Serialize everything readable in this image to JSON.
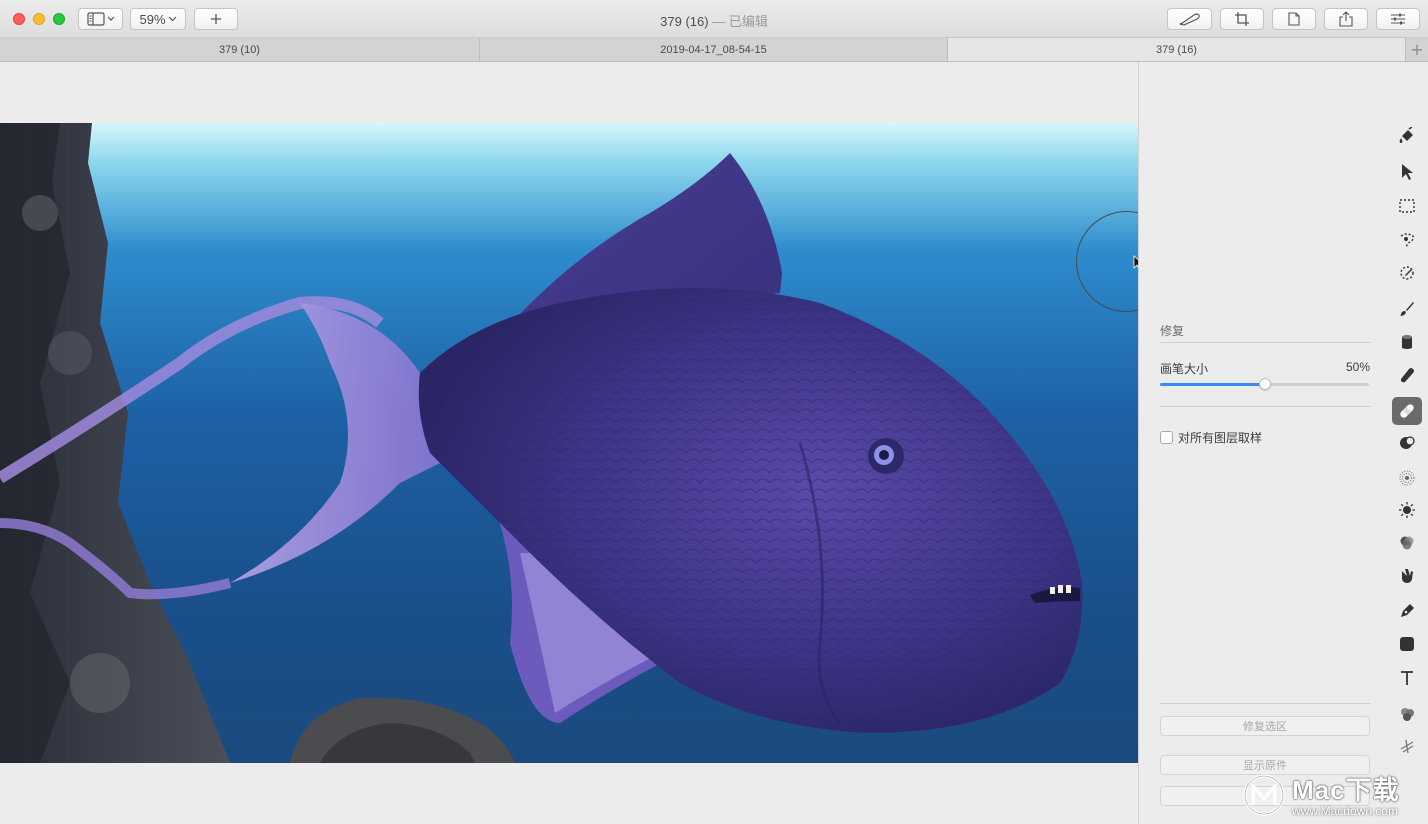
{
  "window": {
    "title": "379 (16)",
    "title_suffix": " — 已编辑",
    "zoom": "59%"
  },
  "tabs": [
    {
      "label": "379 (10)",
      "active": false
    },
    {
      "label": "2019-04-17_08-54-15",
      "active": false
    },
    {
      "label": "379 (16)",
      "active": true
    }
  ],
  "inspector": {
    "section_title": "修复",
    "brush_size_label": "画笔大小",
    "brush_size_value": "50%",
    "brush_size_fraction": 0.5,
    "sample_all_layers_label": "对所有图层取样",
    "sample_all_layers_checked": false,
    "repair_selection_button": "修复选区",
    "show_original_button": "显示原件"
  },
  "tools": [
    {
      "name": "paint-bucket-icon",
      "active": false
    },
    {
      "name": "arrow-select-icon",
      "active": false
    },
    {
      "name": "rect-select-icon",
      "active": false
    },
    {
      "name": "lasso-select-icon",
      "active": false
    },
    {
      "name": "quick-select-icon",
      "active": false
    },
    {
      "name": "paint-brush-icon",
      "active": false
    },
    {
      "name": "paint-can-icon",
      "active": false
    },
    {
      "name": "eraser-icon",
      "active": false
    },
    {
      "name": "repair-bandage-icon",
      "active": true
    },
    {
      "name": "clone-icon",
      "active": false
    },
    {
      "name": "blur-icon",
      "active": false
    },
    {
      "name": "lighten-icon",
      "active": false
    },
    {
      "name": "color-adjust-icon",
      "active": false
    },
    {
      "name": "smudge-icon",
      "active": false
    },
    {
      "name": "pen-icon",
      "active": false
    },
    {
      "name": "shape-icon",
      "active": false
    },
    {
      "name": "text-icon",
      "active": false
    },
    {
      "name": "effects-icon",
      "active": false
    },
    {
      "name": "more-tools-icon",
      "active": false
    }
  ],
  "watermark": {
    "brand": "Mac下载",
    "url": "www.Macdown.com"
  },
  "colors": {
    "accent": "#3b8af2",
    "active_tool_bg": "#6b6b6b"
  }
}
